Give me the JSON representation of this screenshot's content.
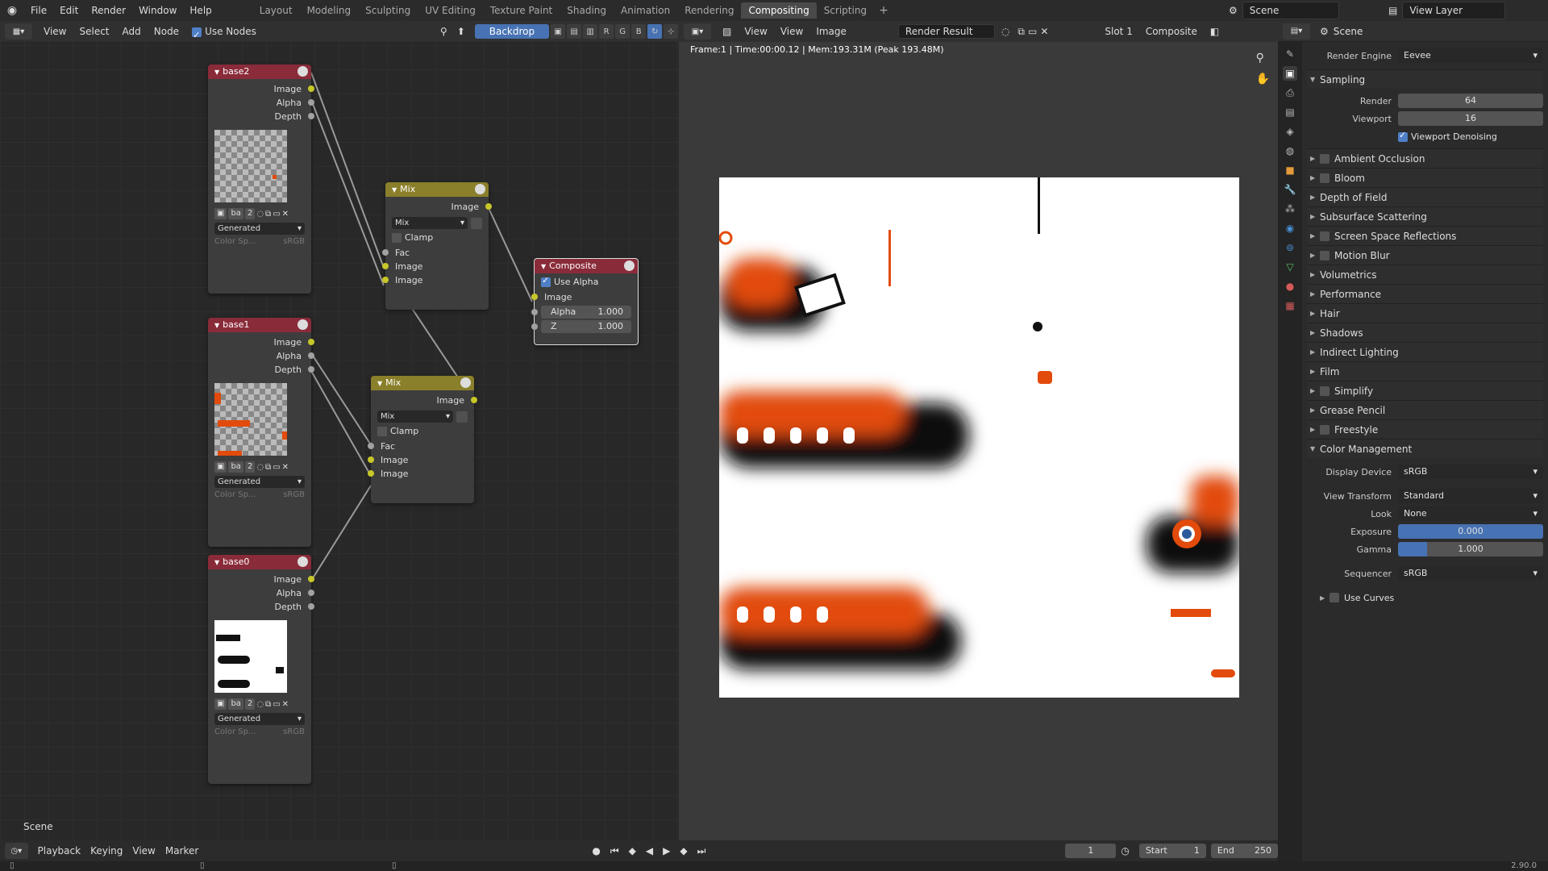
{
  "menu": {
    "items": [
      "File",
      "Edit",
      "Render",
      "Window",
      "Help"
    ]
  },
  "workspaces": [
    "Layout",
    "Modeling",
    "Sculpting",
    "UV Editing",
    "Texture Paint",
    "Shading",
    "Animation",
    "Rendering",
    "Compositing",
    "Scripting"
  ],
  "active_workspace": "Compositing",
  "topright": {
    "scene": "Scene",
    "view_layer": "View Layer"
  },
  "node_editor": {
    "header": {
      "view": "View",
      "select": "Select",
      "add": "Add",
      "node": "Node",
      "use_nodes": "Use Nodes",
      "backdrop": "Backdrop"
    },
    "scene_label": "Scene",
    "nodes": {
      "base2": {
        "title": "base2",
        "outputs": [
          "Image",
          "Alpha",
          "Depth"
        ],
        "img_name": "ba",
        "users": "2",
        "source": "Generated",
        "colorspace_label": "Color Sp...",
        "colorspace": "sRGB"
      },
      "base1": {
        "title": "base1",
        "outputs": [
          "Image",
          "Alpha",
          "Depth"
        ],
        "img_name": "ba",
        "users": "2",
        "source": "Generated",
        "colorspace_label": "Color Sp...",
        "colorspace": "sRGB"
      },
      "base0": {
        "title": "base0",
        "outputs": [
          "Image",
          "Alpha",
          "Depth"
        ],
        "img_name": "ba",
        "users": "2",
        "source": "Generated",
        "colorspace_label": "Color Sp...",
        "colorspace": "sRGB"
      },
      "mix1": {
        "title": "Mix",
        "output": "Image",
        "mode": "Mix",
        "clamp": "Clamp",
        "inputs": [
          "Fac",
          "Image",
          "Image"
        ]
      },
      "mix2": {
        "title": "Mix",
        "output": "Image",
        "mode": "Mix",
        "clamp": "Clamp",
        "inputs": [
          "Fac",
          "Image",
          "Image"
        ]
      },
      "composite": {
        "title": "Composite",
        "use_alpha": "Use Alpha",
        "input": "Image",
        "alpha_label": "Alpha",
        "alpha_value": "1.000",
        "z_label": "Z",
        "z_value": "1.000"
      }
    }
  },
  "image_editor": {
    "header": {
      "view1": "View",
      "view2": "View",
      "image": "Image",
      "image_name": "Render Result",
      "slot": "Slot 1",
      "pass": "Composite"
    },
    "info": "Frame:1 | Time:00:00.12 | Mem:193.31M (Peak 193.48M)"
  },
  "properties": {
    "header_title": "Scene",
    "render_engine_label": "Render Engine",
    "render_engine": "Eevee",
    "sampling": {
      "title": "Sampling",
      "render_label": "Render",
      "render": "64",
      "viewport_label": "Viewport",
      "viewport": "16",
      "denoise": "Viewport Denoising"
    },
    "panels": [
      {
        "label": "Ambient Occlusion",
        "check": true
      },
      {
        "label": "Bloom",
        "check": true
      },
      {
        "label": "Depth of Field",
        "check": false
      },
      {
        "label": "Subsurface Scattering",
        "check": false
      },
      {
        "label": "Screen Space Reflections",
        "check": true
      },
      {
        "label": "Motion Blur",
        "check": true
      },
      {
        "label": "Volumetrics",
        "check": false
      },
      {
        "label": "Performance",
        "check": false
      },
      {
        "label": "Hair",
        "check": false
      },
      {
        "label": "Shadows",
        "check": false
      },
      {
        "label": "Indirect Lighting",
        "check": false
      },
      {
        "label": "Film",
        "check": false
      },
      {
        "label": "Simplify",
        "check": true
      },
      {
        "label": "Grease Pencil",
        "check": false
      },
      {
        "label": "Freestyle",
        "check": true
      }
    ],
    "color_management": {
      "title": "Color Management",
      "display_device_label": "Display Device",
      "display_device": "sRGB",
      "view_transform_label": "View Transform",
      "view_transform": "Standard",
      "look_label": "Look",
      "look": "None",
      "exposure_label": "Exposure",
      "exposure": "0.000",
      "gamma_label": "Gamma",
      "gamma": "1.000",
      "sequencer_label": "Sequencer",
      "sequencer": "sRGB",
      "use_curves": "Use Curves"
    }
  },
  "timeline": {
    "playback": "Playback",
    "keying": "Keying",
    "view": "View",
    "marker": "Marker",
    "frame": "1",
    "start_label": "Start",
    "start": "1",
    "end_label": "End",
    "end": "250"
  },
  "statusbar": {
    "version": "2.90.0"
  },
  "colors": {
    "accent": "#4772b3",
    "image_node": "#8a2b3a",
    "color_node": "#8a7f2a",
    "socket_color": "#c7c729"
  }
}
